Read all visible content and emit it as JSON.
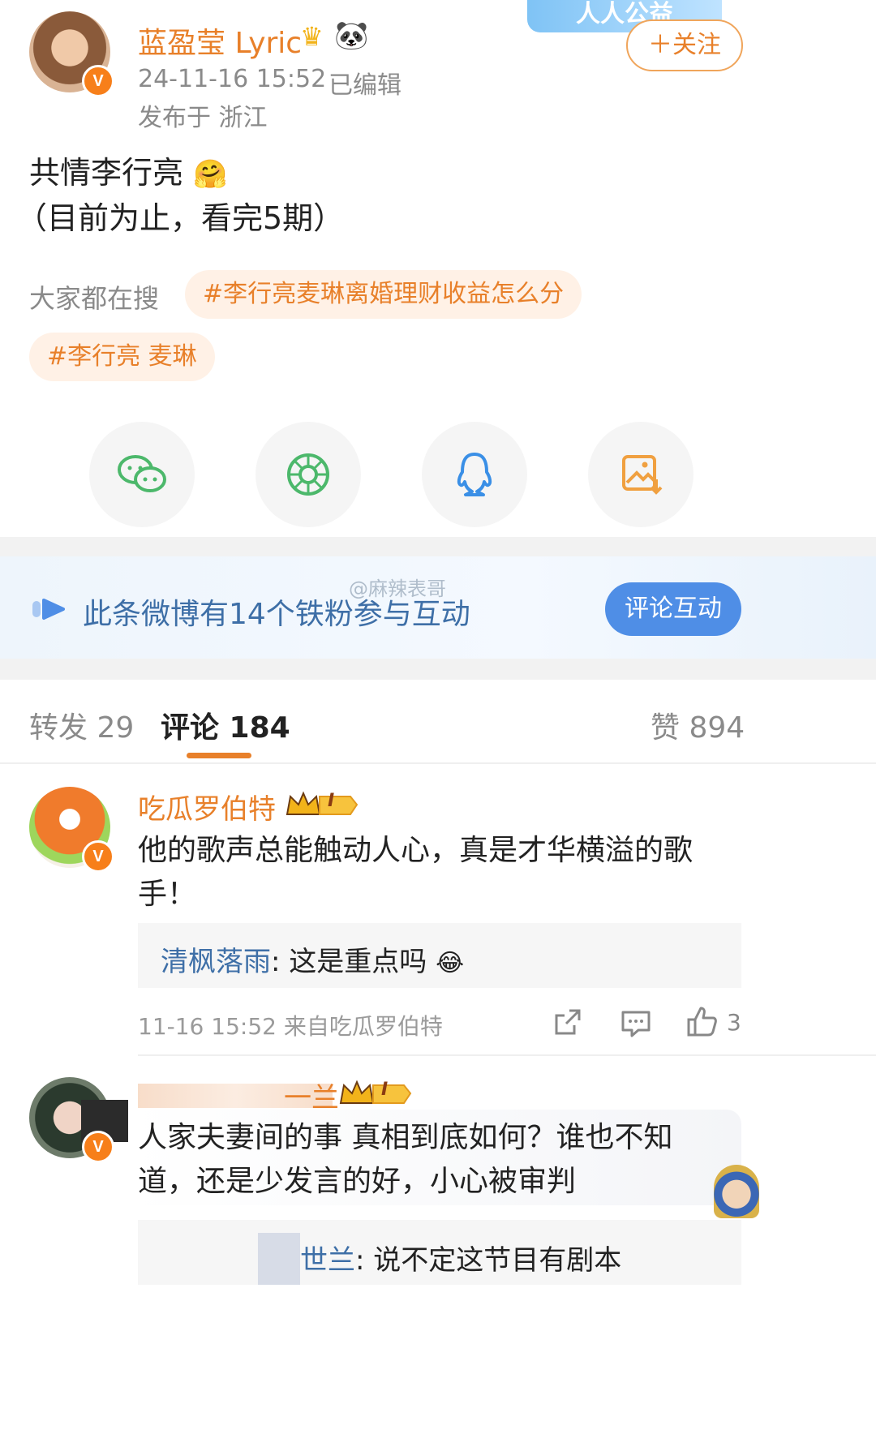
{
  "post": {
    "author": "蓝盈莹 Lyric",
    "time": "24-11-16 15:52",
    "edited": "已编辑",
    "location": "发布于 浙江",
    "follow_label": "＋关注",
    "banner_text": "人人公益",
    "content_line1": "共情李行亮",
    "content_line2": "（目前为止，看完5期）",
    "search_label": "大家都在搜",
    "topics": [
      "#李行亮麦琳离婚理财收益怎么分",
      "#李行亮 麦琳"
    ]
  },
  "share": {
    "items": [
      "wechat-icon",
      "moments-icon",
      "qq-icon",
      "save-image-icon"
    ]
  },
  "fans_banner": {
    "text": "此条微博有14个铁粉参与互动",
    "button": "评论互动",
    "watermark": "@麻辣表哥"
  },
  "tabs": {
    "repost": "转发 29",
    "comments": "评论 184",
    "likes": "赞 894"
  },
  "comments": [
    {
      "username": "吃瓜罗伯特",
      "level": "I",
      "text": "他的歌声总能触动人心，真是才华横溢的歌手！",
      "reply_user": "清枫落雨",
      "reply_text": ": 这是重点吗",
      "time_source": "11-16 15:52  来自吃瓜罗伯特",
      "like_count": "3"
    },
    {
      "username": "一兰",
      "level": "I",
      "text": "人家夫妻间的事 真相到底如何？谁也不知道，还是少发言的好，小心被审判",
      "reply_user": "世兰",
      "reply_text": ": 说不定这节目有剧本"
    }
  ],
  "colors": {
    "accent_orange": "#e8802a",
    "link_blue": "#3e6fa7",
    "fans_button": "#4f8ee6"
  }
}
